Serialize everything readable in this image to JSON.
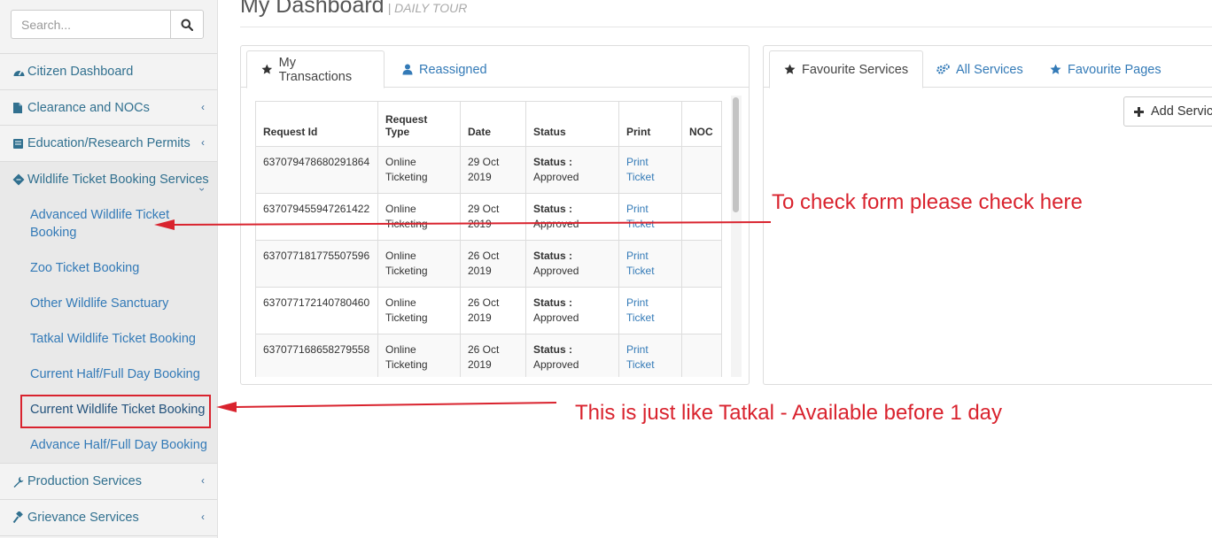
{
  "search": {
    "placeholder": "Search..."
  },
  "sidebar": {
    "items": [
      {
        "label": "Citizen Dashboard"
      },
      {
        "label": "Clearance and NOCs"
      },
      {
        "label": "Education/Research Permits"
      },
      {
        "label": "Wildlife Ticket Booking Services"
      },
      {
        "label": "Production Services"
      },
      {
        "label": "Grievance Services"
      }
    ],
    "subitems": [
      {
        "label": "Advanced Wildlife Ticket Booking"
      },
      {
        "label": "Zoo Ticket Booking"
      },
      {
        "label": "Other Wildlife Sanctuary"
      },
      {
        "label": "Tatkal Wildlife Ticket Booking"
      },
      {
        "label": "Current Half/Full Day Booking"
      },
      {
        "label": "Current Wildlife Ticket Booking"
      },
      {
        "label": "Advance Half/Full Day Booking"
      }
    ]
  },
  "header": {
    "title": "My Dashboard",
    "subtitle": "| DAILY TOUR"
  },
  "transactions": {
    "tabs": [
      {
        "label": "My Transactions"
      },
      {
        "label": "Reassigned"
      }
    ],
    "columns": [
      "Request Id",
      "Request Type",
      "Date",
      "Status",
      "Print",
      "NOC"
    ],
    "rows": [
      {
        "id": "637079478680291864",
        "type": "Online Ticketing",
        "date": "29 Oct 2019",
        "status_label": "Status :",
        "status": "Approved",
        "print": "Print Ticket",
        "noc": ""
      },
      {
        "id": "637079455947261422",
        "type": "Online Ticketing",
        "date": "29 Oct 2019",
        "status_label": "Status :",
        "status": "Approved",
        "print": "Print Ticket",
        "noc": ""
      },
      {
        "id": "637077181775507596",
        "type": "Online Ticketing",
        "date": "26 Oct 2019",
        "status_label": "Status :",
        "status": "Approved",
        "print": "Print Ticket",
        "noc": ""
      },
      {
        "id": "637077172140780460",
        "type": "Online Ticketing",
        "date": "26 Oct 2019",
        "status_label": "Status :",
        "status": "Approved",
        "print": "Print Ticket",
        "noc": ""
      },
      {
        "id": "637077168658279558",
        "type": "Online Ticketing",
        "date": "26 Oct 2019",
        "status_label": "Status :",
        "status": "Approved",
        "print": "Print Ticket",
        "noc": ""
      }
    ]
  },
  "services": {
    "tabs": [
      {
        "label": "Favourite Services"
      },
      {
        "label": "All Services"
      },
      {
        "label": "Favourite Pages"
      }
    ],
    "add_button": "Add Service"
  },
  "annotations": {
    "note1": "To check form please check here",
    "note2": "This is just like Tatkal - Available before 1 day"
  },
  "colors": {
    "link": "#337ab7",
    "annotation": "#d9232e"
  }
}
